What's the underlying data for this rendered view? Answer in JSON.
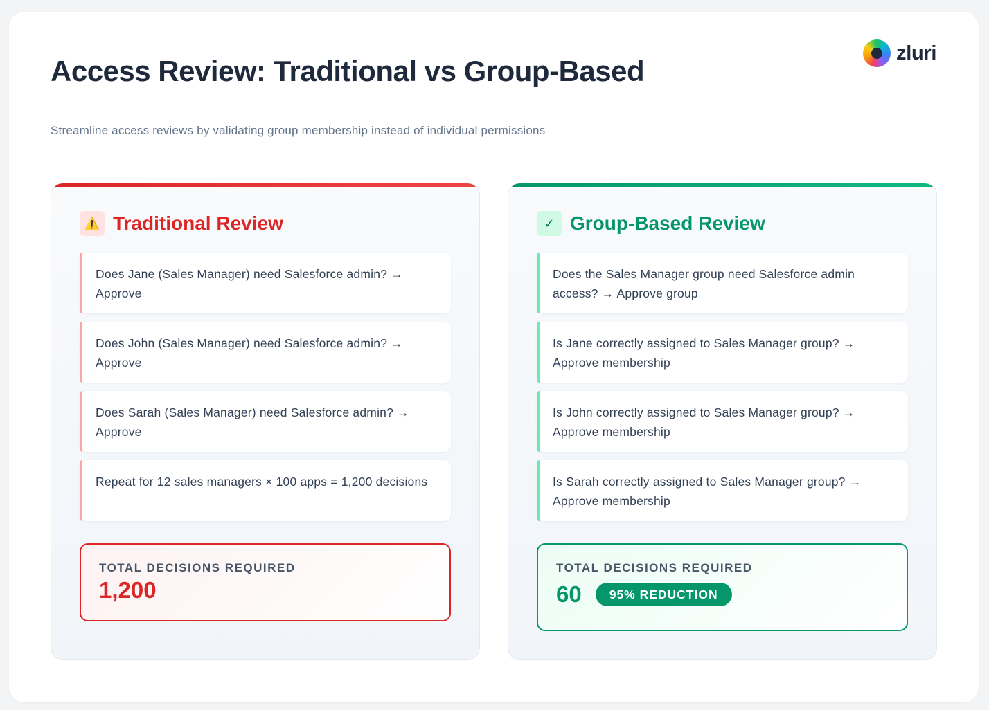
{
  "header": {
    "title": "Access Review: Traditional vs Group-Based",
    "subtitle": "Streamline access reviews by validating group membership instead of individual permissions"
  },
  "logo": {
    "text": "zluri",
    "icon": "zluri-logo-icon"
  },
  "traditional": {
    "icon": "warning-icon",
    "icon_glyph": "⚠️",
    "title": "Traditional Review",
    "accent_color": "#dc2626",
    "items": [
      "Does Jane (Sales Manager) need Salesforce admin? → Approve",
      "Does John (Sales Manager) need Salesforce admin? → Approve",
      "Does Sarah (Sales Manager) need Salesforce admin? → Approve",
      "Repeat for 12 sales managers × 100 apps = 1,200 decisions"
    ],
    "total_label": "TOTAL DECISIONS REQUIRED",
    "total_value": "1,200"
  },
  "group_based": {
    "icon": "check-icon",
    "icon_glyph": "✓",
    "title": "Group-Based Review",
    "accent_color": "#059669",
    "items": [
      "Does the Sales Manager group need Salesforce admin access? → Approve group",
      "Is Jane correctly assigned to Sales Manager group? → Approve membership",
      "Is John correctly assigned to Sales Manager group? → Approve membership",
      "Is Sarah correctly assigned to Sales Manager group? → Approve membership"
    ],
    "total_label": "TOTAL DECISIONS REQUIRED",
    "total_value": "60",
    "reduction_badge": "95% REDUCTION"
  }
}
